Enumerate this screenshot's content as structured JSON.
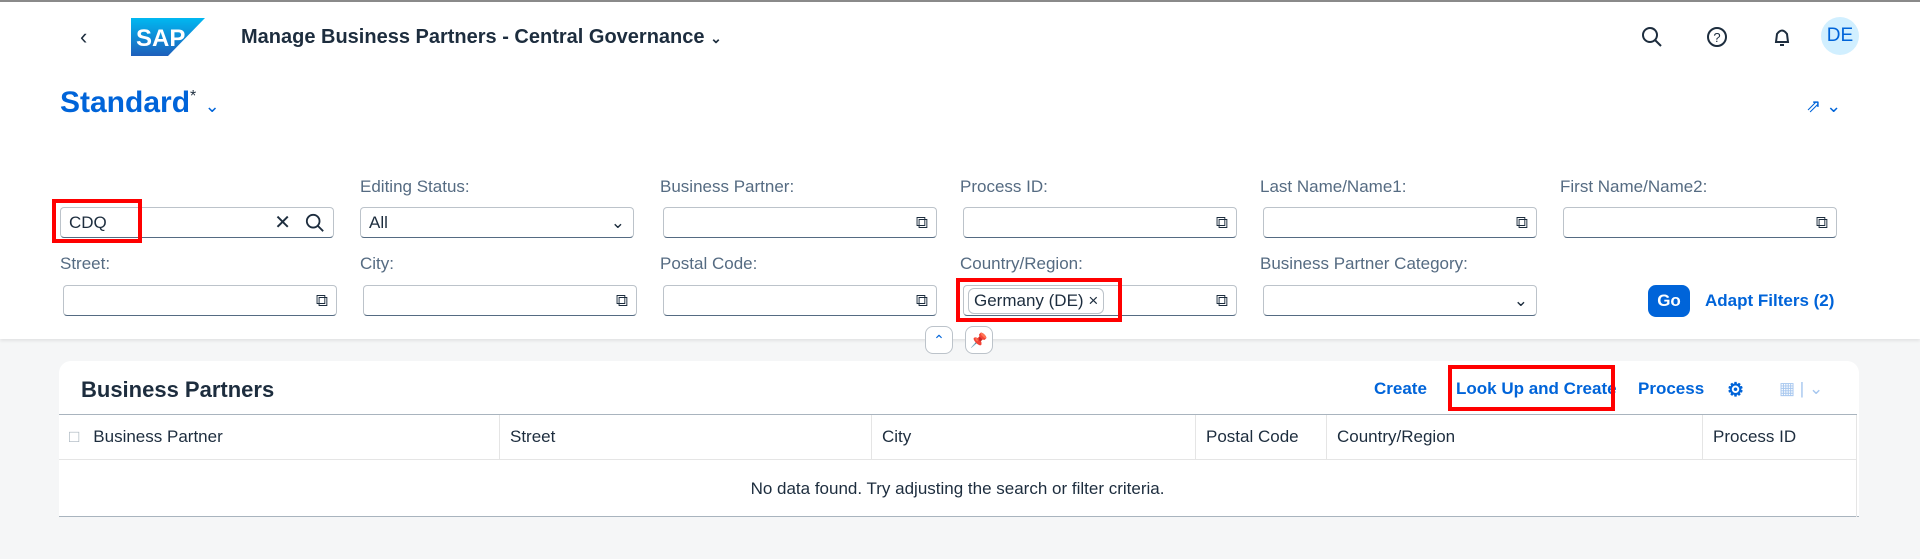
{
  "header": {
    "title": "Manage Business Partners - Central Governance",
    "avatar": "DE",
    "logo_text": "SAP",
    "icons": [
      "back-icon",
      "search-icon",
      "help-icon",
      "bell-icon"
    ]
  },
  "variant": {
    "name": "Standard",
    "modified": "*"
  },
  "filters": {
    "search_value": "CDQ",
    "editing_status": {
      "label": "Editing Status:",
      "value": "All"
    },
    "business_partner": {
      "label": "Business Partner:"
    },
    "process_id": {
      "label": "Process ID:"
    },
    "last_name": {
      "label": "Last Name/Name1:"
    },
    "first_name": {
      "label": "First Name/Name2:"
    },
    "street": {
      "label": "Street:"
    },
    "city": {
      "label": "City:"
    },
    "postal_code": {
      "label": "Postal Code:"
    },
    "country": {
      "label": "Country/Region:",
      "token": "Germany (DE)"
    },
    "category": {
      "label": "Business Partner Category:"
    },
    "go": "Go",
    "adapt": "Adapt Filters (2)"
  },
  "table": {
    "title": "Business Partners",
    "actions": {
      "create": "Create",
      "lookup": "Look Up and Create",
      "process": "Process"
    },
    "columns": [
      "Business Partner",
      "Street",
      "City",
      "Postal Code",
      "Country/Region",
      "Process ID"
    ],
    "no_data": "No data found. Try adjusting the search or filter criteria."
  },
  "colors": {
    "accent": "#0064d9",
    "highlight": "#ff0000"
  }
}
